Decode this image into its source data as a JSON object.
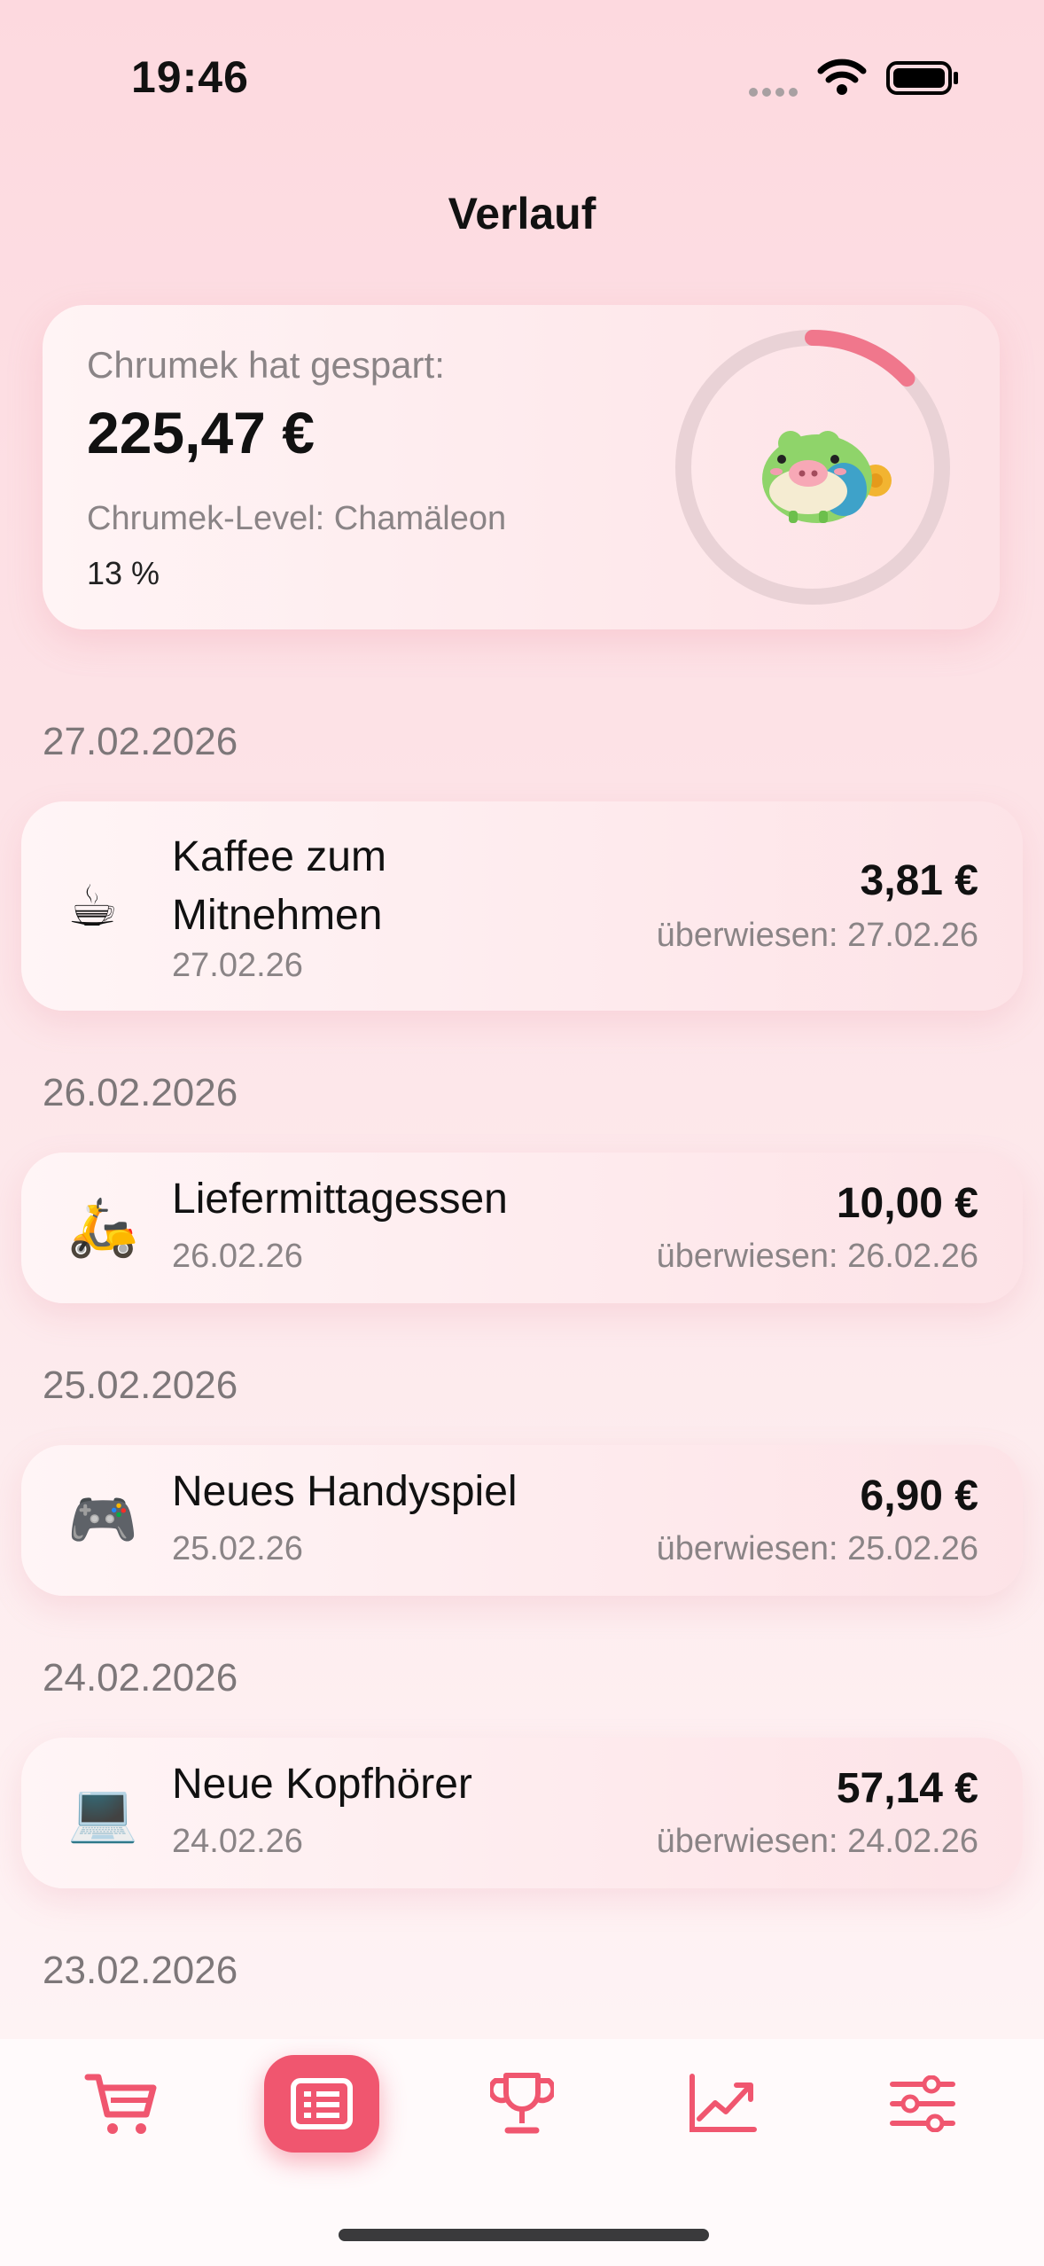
{
  "status_bar": {
    "time": "19:46"
  },
  "screen_title": "Verlauf",
  "summary": {
    "label": "Chrumek hat gespart:",
    "amount": "225,47 €",
    "level": "Chrumek-Level: Chamäleon",
    "percent_label": "13 %",
    "progress": 0.13,
    "ring_color": "#f0778c",
    "ring_track_color": "#e9d2d6"
  },
  "entries": [
    {
      "date_header": "27.02.2026",
      "icon": "coffee-icon",
      "emoji": "☕",
      "name_line1": "Kaffee zum",
      "name_line2": "Mitnehmen",
      "date": "27.02.26",
      "amount": "3,81 €",
      "transferred": "überwiesen: 27.02.26"
    },
    {
      "date_header": "26.02.2026",
      "icon": "scooter-icon",
      "emoji": "🛵",
      "name": "Liefermittagessen",
      "date": "26.02.26",
      "amount": "10,00 €",
      "transferred": "überwiesen: 26.02.26"
    },
    {
      "date_header": "25.02.2026",
      "icon": "gamepad-icon",
      "emoji": "🎮",
      "name": "Neues Handyspiel",
      "date": "25.02.26",
      "amount": "6,90 €",
      "transferred": "überwiesen: 25.02.26"
    },
    {
      "date_header": "24.02.2026",
      "icon": "laptop-icon",
      "emoji": "💻",
      "name": "Neue Kopfhörer",
      "date": "24.02.26",
      "amount": "57,14 €",
      "transferred": "überwiesen: 24.02.26"
    },
    {
      "date_header": "23.02.2026"
    }
  ],
  "tabbar": {
    "active_color": "#f0566f",
    "items": [
      "cart-icon",
      "list-icon",
      "trophy-icon",
      "chart-icon",
      "sliders-icon"
    ],
    "active_index": 1
  }
}
